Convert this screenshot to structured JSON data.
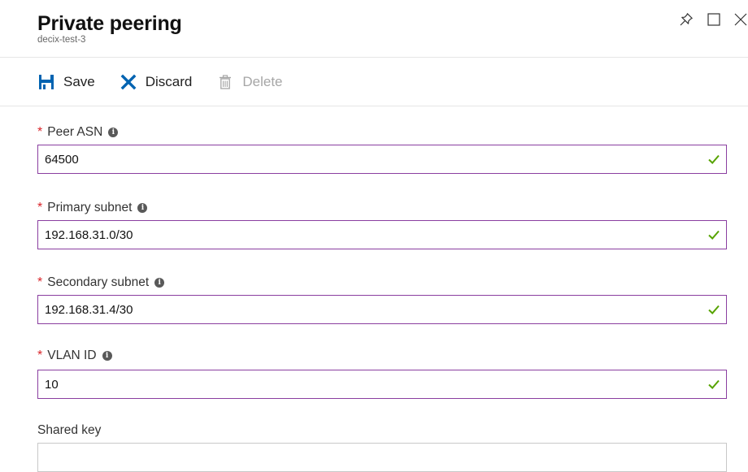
{
  "header": {
    "title": "Private peering",
    "subtitle": "decix-test-3"
  },
  "window_controls": {
    "pin_icon": "pin-icon",
    "maximize_icon": "maximize-icon",
    "close_icon": "close-icon"
  },
  "toolbar": {
    "save_label": "Save",
    "discard_label": "Discard",
    "delete_label": "Delete"
  },
  "form": {
    "peer_asn": {
      "label": "Peer ASN",
      "required": "*",
      "value": "64500",
      "info": "i"
    },
    "primary_subnet": {
      "label": "Primary subnet",
      "required": "*",
      "value": "192.168.31.0/30",
      "info": "i"
    },
    "secondary_subnet": {
      "label": "Secondary subnet",
      "required": "*",
      "value": "192.168.31.4/30",
      "info": "i"
    },
    "vlan_id": {
      "label": "VLAN ID",
      "required": "*",
      "value": "10",
      "info": "i"
    },
    "shared_key": {
      "label": "Shared key",
      "value": ""
    }
  },
  "colors": {
    "accent": "#0063b1",
    "required": "#d9252a",
    "input_border_valid": "#8a3ea0",
    "check": "#57a300",
    "disabled_text": "#a6a6a6"
  }
}
